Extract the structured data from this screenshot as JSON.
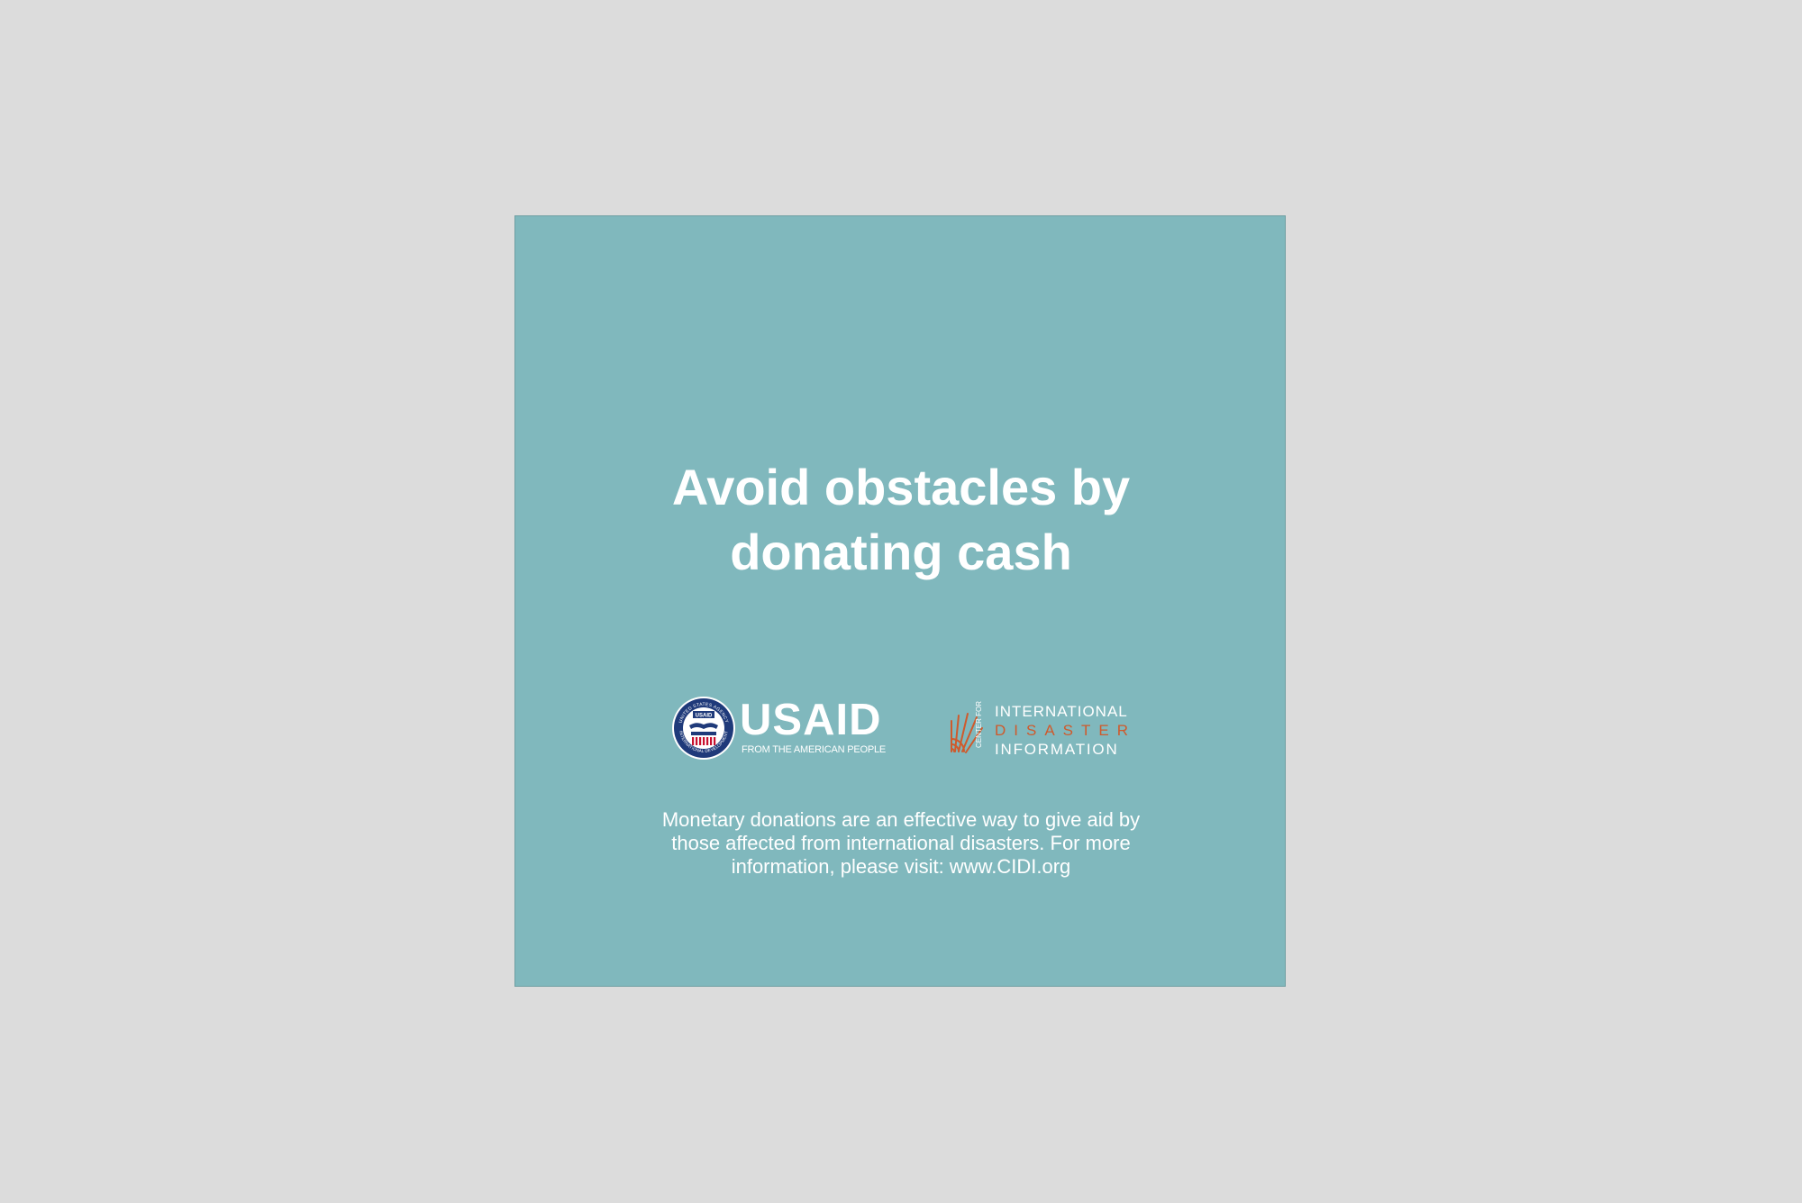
{
  "colors": {
    "page_background": "#dcdcdc",
    "card_background": "#80b8bd",
    "text": "#ffffff",
    "cidi_accent": "#cf5a2c"
  },
  "headline": {
    "line1": "Avoid obstacles by",
    "line2": "donating cash"
  },
  "usaid_logo": {
    "wordmark": "USAID",
    "tagline": "FROM THE AMERICAN PEOPLE",
    "seal_text": "UNITED STATES AGENCY INTERNATIONAL DEVELOPMENT",
    "seal_label": "USAID",
    "icon": "usaid-seal-icon"
  },
  "cidi_logo": {
    "center_for": "CENTER FOR",
    "line1": "INTERNATIONAL",
    "line2": "DISASTER",
    "line3": "INFORMATION",
    "icon": "sun-rays-icon"
  },
  "body": {
    "line1": "Monetary donations are an effective way to give aid by",
    "line2": "those affected from international disasters. For more",
    "line3": "information, please visit: www.CIDI.org"
  }
}
